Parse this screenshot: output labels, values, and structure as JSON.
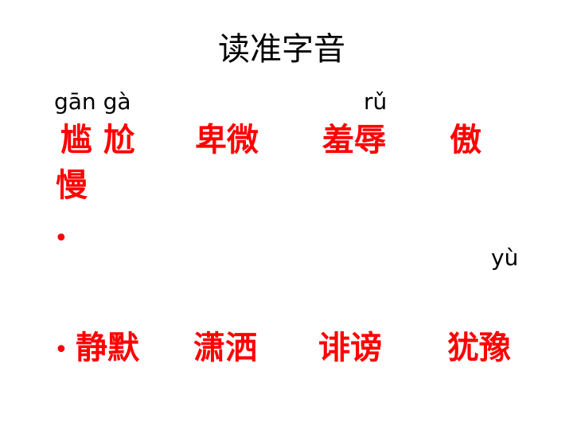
{
  "title": "读准字音",
  "pinyin": {
    "p1": "gān  gà",
    "p2": "rǔ",
    "p3": "yù"
  },
  "row1": {
    "w1": "尴 尬",
    "w2": "卑微",
    "w3": "羞辱",
    "w4": "傲",
    "w5": "慢"
  },
  "row2": {
    "bullet_symbol": "•",
    "w1": "静默",
    "w2": "潇洒",
    "w3": "诽谤",
    "w4": "犹豫"
  },
  "colors": {
    "text": "#000000",
    "accent": "#ff0000",
    "background": "#ffffff"
  }
}
